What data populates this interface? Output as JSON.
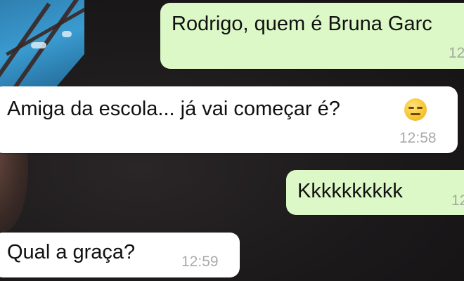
{
  "chat": {
    "messages": [
      {
        "direction": "sent",
        "text": "Rodrigo, quem é Bruna Garc",
        "time": "12"
      },
      {
        "direction": "received",
        "text": "Amiga da escola... já vai começar é?",
        "emoji": "expressionless-face",
        "time": "12:58"
      },
      {
        "direction": "sent",
        "text": "Kkkkkkkkkk",
        "time": "12"
      },
      {
        "direction": "received",
        "text": "Qual a graça?",
        "time": "12:59"
      }
    ]
  },
  "colors": {
    "sent_bubble": "#dcf8c6",
    "received_bubble": "#ffffff",
    "background": "#1c1a1b"
  }
}
